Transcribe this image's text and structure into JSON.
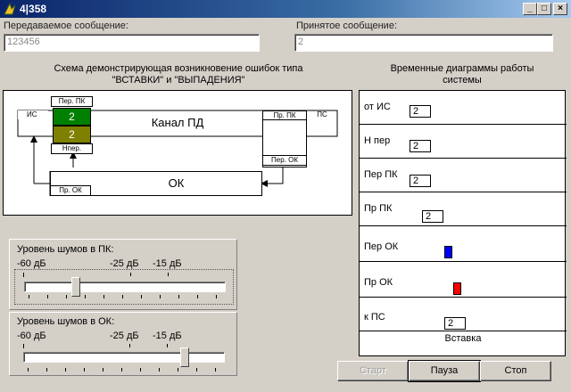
{
  "window": {
    "title": "4|358",
    "minimize": "_",
    "maximize": "□",
    "close": "×"
  },
  "sent": {
    "label": "Передаваемое сообщение:",
    "value": "123456"
  },
  "received": {
    "label": "Принятое сообщение:",
    "value": "2"
  },
  "schema": {
    "caption_line1": "Схема демонстрирующая возникновение ошибок типа",
    "caption_line2": "\"ВСТАВКИ\" и \"ВЫПАДЕНИЯ\"",
    "is_label": "ИС",
    "per_pk": "Пер. ПК",
    "value_green": "2",
    "value_olive": "2",
    "n_per": "Нпер.",
    "channel": "Канал ПД",
    "pr_pk": "Пр. ПК",
    "ps_label": "ПС",
    "per_ok": "Пер. ОК",
    "pr_ok": "Пр. ОК",
    "ok": "ОК"
  },
  "timing": {
    "caption_line1": "Временные диаграммы работы",
    "caption_line2": "системы",
    "rows": [
      {
        "label": "от ИС",
        "value": "2"
      },
      {
        "label": "Н пер",
        "value": "2"
      },
      {
        "label": "Пер ПК",
        "value": "2"
      },
      {
        "label": "Пр ПК",
        "value": "2"
      },
      {
        "label": "Пер ОК",
        "value": ""
      },
      {
        "label": "Пр ОК",
        "value": ""
      },
      {
        "label": "к ПС",
        "value": "2"
      }
    ],
    "status": "Вставка",
    "colors": {
      "per_ok_mark": "#0000ff",
      "pr_ok_mark": "#ff0000"
    }
  },
  "noise_pk": {
    "label": "Уровень шумов в ПК:",
    "ticks": [
      "-60 дБ",
      "-25 дБ",
      "-15 дБ"
    ]
  },
  "noise_ok": {
    "label": "Уровень шумов в ОК:",
    "ticks": [
      "-60 дБ",
      "-25 дБ",
      "-15 дБ"
    ]
  },
  "buttons": {
    "start": "Старт",
    "pause": "Пауза",
    "stop": "Стоп"
  },
  "colors": {
    "title_bar": "#0a246a",
    "green": "#008000",
    "olive": "#808000"
  }
}
